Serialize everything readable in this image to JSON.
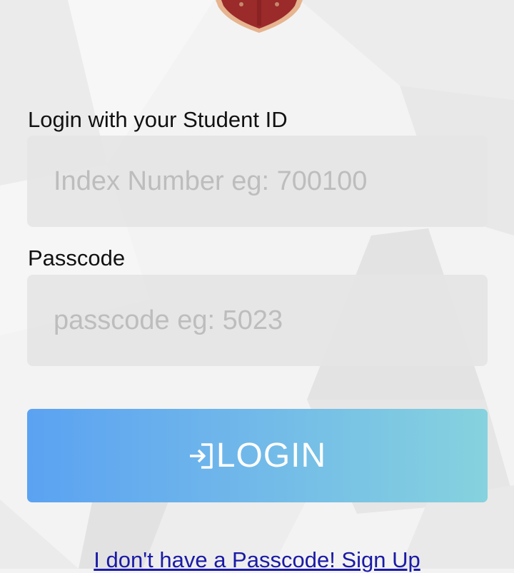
{
  "login_form": {
    "student_id_label": "Login with your Student ID",
    "student_id_placeholder": "Index Number eg: 700100",
    "student_id_value": "",
    "passcode_label": "Passcode",
    "passcode_placeholder": "passcode eg: 5023",
    "passcode_value": "",
    "login_button_label": "LOGIN",
    "login_icon": "sign-in-icon",
    "signup_link": "I don't have a Passcode! Sign Up"
  },
  "crest": {
    "icon": "school-crest-icon"
  },
  "colors": {
    "background": "#f3f3f3",
    "field_background": "#e5e5e5",
    "button_gradient_start": "#5ba2f2",
    "button_gradient_end": "#86d2de",
    "link": "#1a1aa6",
    "crest_red": "#9b2a2a",
    "crest_rim": "#e6b48f"
  }
}
